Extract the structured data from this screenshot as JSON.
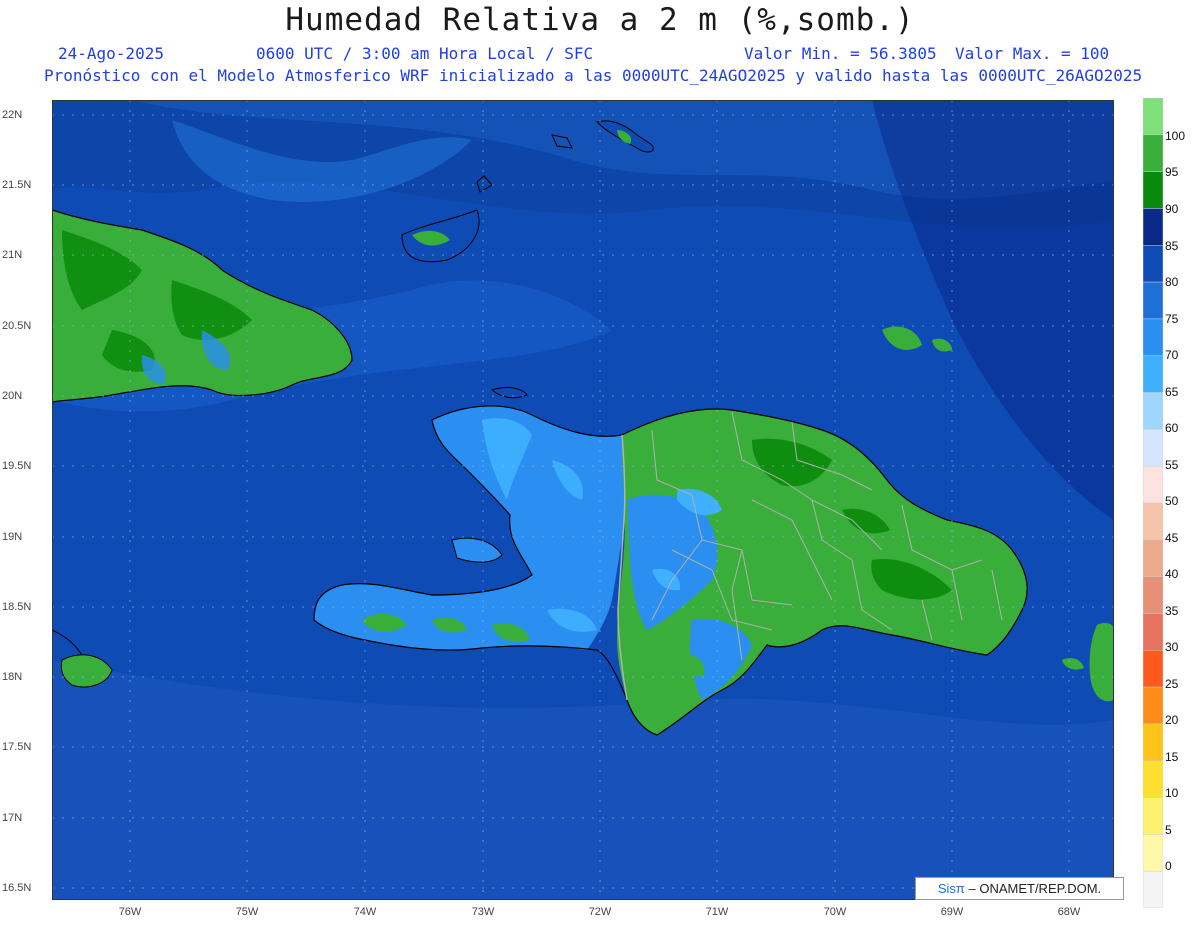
{
  "title": "Humedad Relativa a 2 m (%,somb.)",
  "header": {
    "date": "24-Ago-2025",
    "time": "0600 UTC / 3:00 am Hora Local / SFC",
    "min": "Valor Min. = 56.3805",
    "max": "Valor Max. = 100",
    "forecast": "Pronóstico con el Modelo Atmosferico WRF inicializado a las 0000UTC_24AGO2025 y valido hasta las  0000UTC_26AGO2025"
  },
  "lat_labels": [
    "22N",
    "21.5N",
    "21N",
    "20.5N",
    "20N",
    "19.5N",
    "19N",
    "18.5N",
    "18N",
    "17.5N",
    "17N",
    "16.5N"
  ],
  "lon_labels": [
    "76W",
    "75W",
    "74W",
    "73W",
    "72W",
    "71W",
    "70W",
    "69W",
    "68W"
  ],
  "colorbar": {
    "labels": [
      "100",
      "95",
      "90",
      "85",
      "80",
      "75",
      "70",
      "65",
      "60",
      "55",
      "50",
      "45",
      "40",
      "35",
      "30",
      "25",
      "20",
      "15",
      "10",
      "5",
      "0"
    ],
    "colors": [
      "#7ee07a",
      "#3aae3a",
      "#0a8a0a",
      "#0a2a8a",
      "#0f4bb5",
      "#1e70d8",
      "#2a8ff0",
      "#3fb0ff",
      "#9ed6ff",
      "#d4e6ff",
      "#fde2e2",
      "#f6c4aa",
      "#eeaa8c",
      "#e88f78",
      "#e5735f",
      "#ff5a1e",
      "#ff8c1a",
      "#ffc31a",
      "#ffe030",
      "#fff070",
      "#fff8a8",
      "#f4f4f4"
    ]
  },
  "credit": {
    "sis": "Sisπ",
    "org": "– ONAMET/REP.DOM."
  },
  "colors": {
    "background": "#0f4bb5",
    "deep": "#0a2a8a",
    "sea_light": "#2a6fcf",
    "land_green": "#3aae3a",
    "land_dark_green": "#0a8a0a",
    "land_blue": "#2a8ff0",
    "header_blue": "#1f3fe0"
  }
}
